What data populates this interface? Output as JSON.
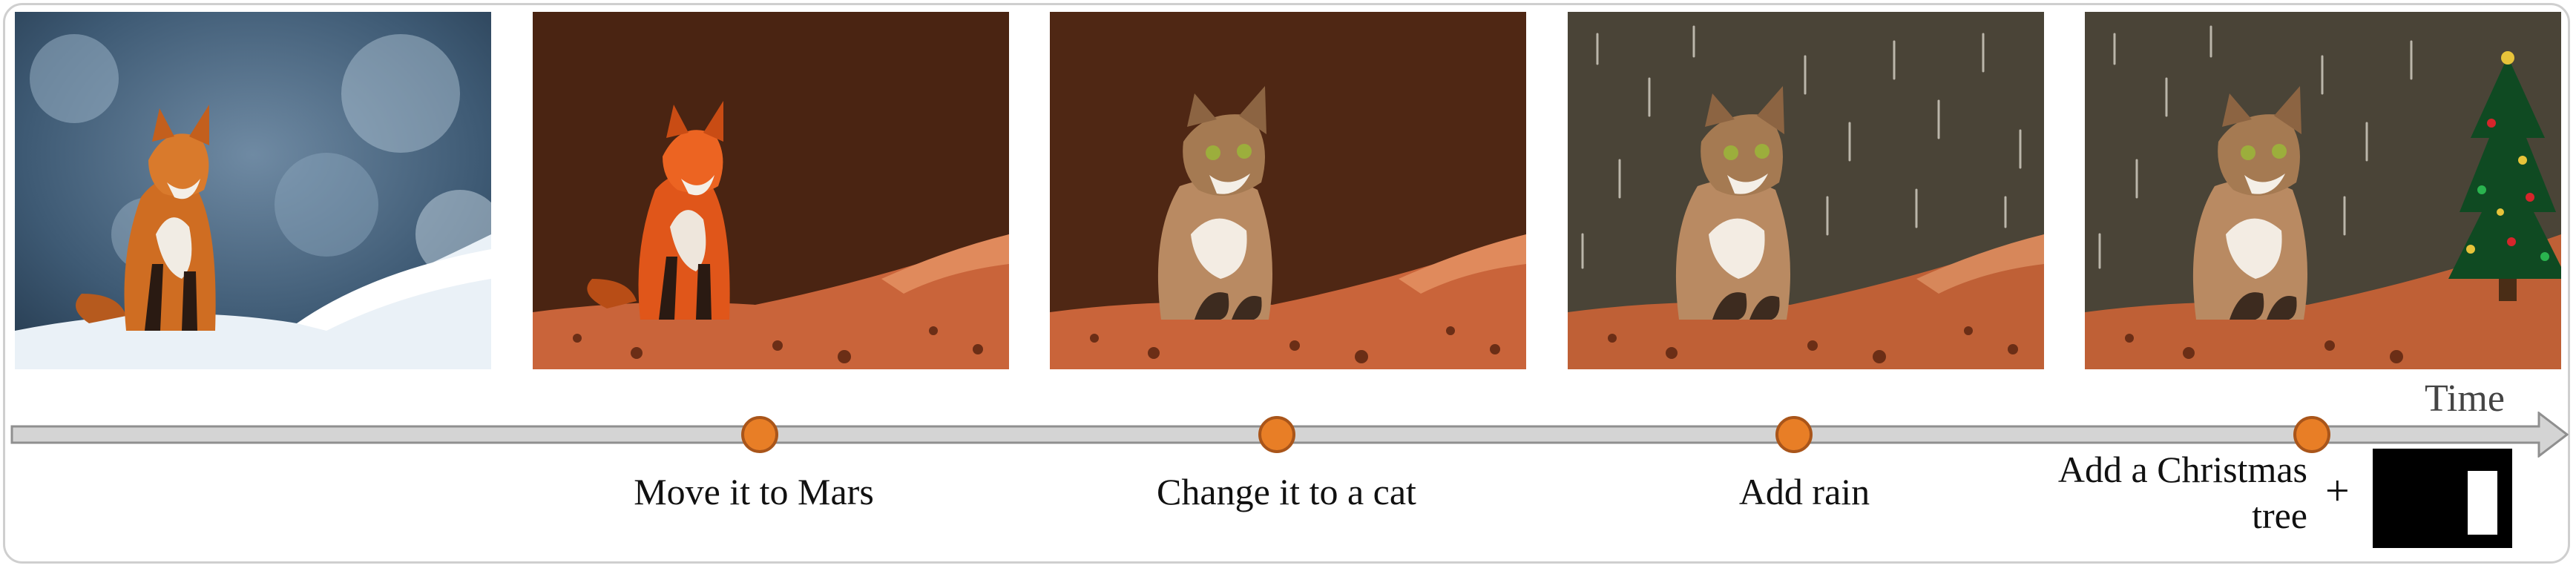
{
  "timeline": {
    "time_label": "Time",
    "steps": [
      {
        "label": "Move it to Mars"
      },
      {
        "label": "Change it to a cat"
      },
      {
        "label": "Add rain"
      },
      {
        "label": "Add a Christmas\ntree"
      }
    ],
    "plus_symbol": "+"
  },
  "colors": {
    "arrow_fill": "#d4d4d4",
    "arrow_stroke": "#8f8f8f",
    "step_marker": "#e87e26",
    "step_marker_stroke": "#a9551a",
    "mars_ground": "#c9643a",
    "mars_sky": "#4a2412"
  }
}
